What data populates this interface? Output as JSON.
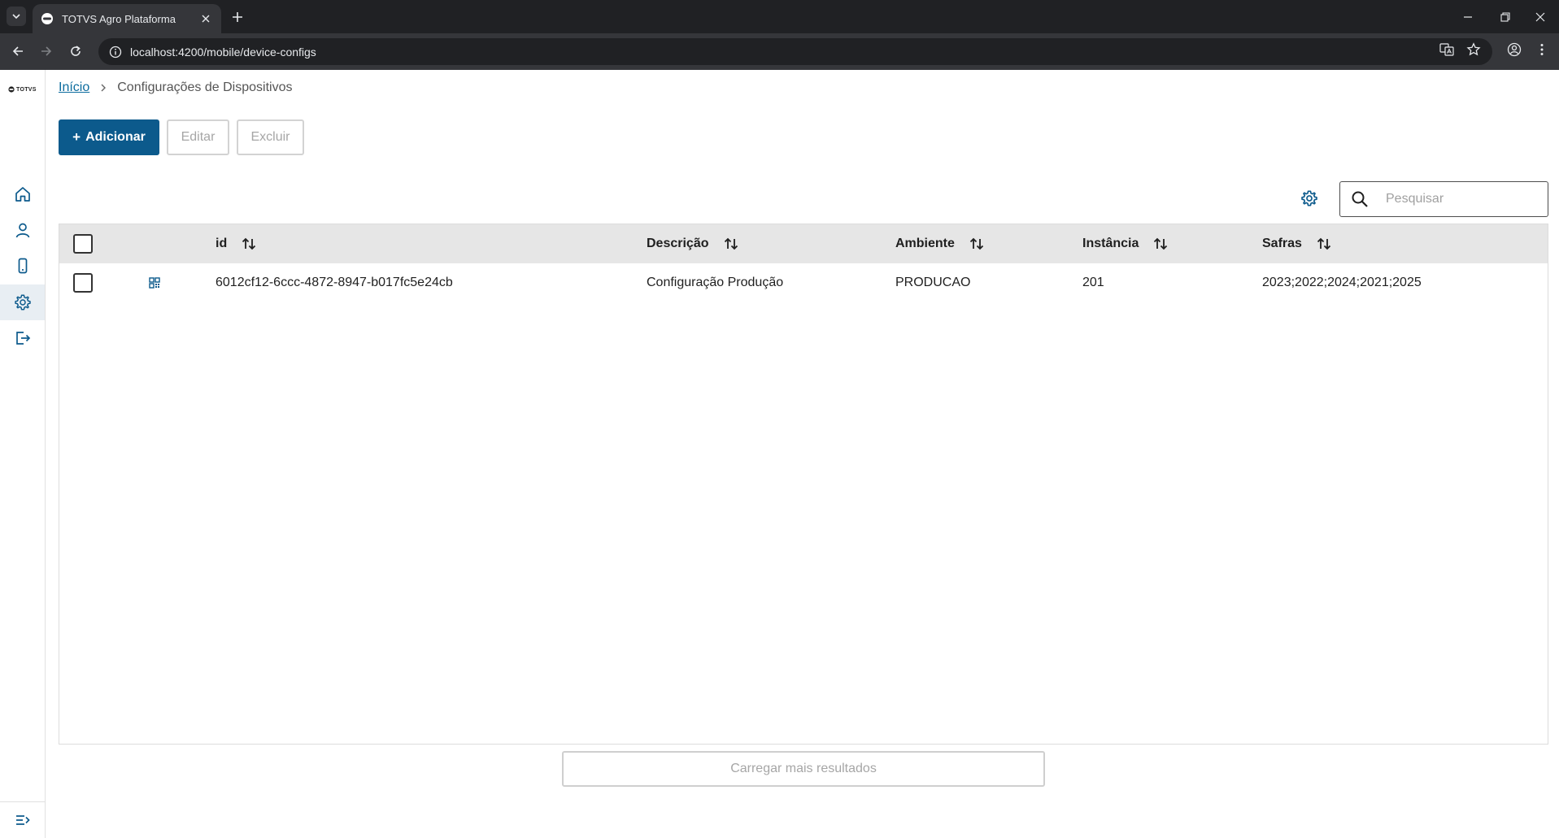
{
  "browser": {
    "tab_title": "TOTVS Agro Plataforma",
    "url": "localhost:4200/mobile/device-configs"
  },
  "sidebar": {
    "brand": "TOTVS",
    "items": [
      "home-icon",
      "user-icon",
      "mobile-device-icon",
      "gear-icon",
      "logout-icon"
    ],
    "active_index": 3
  },
  "breadcrumb": {
    "home": "Início",
    "current": "Configurações de Dispositivos"
  },
  "actions": {
    "add_plus": "+",
    "add": "Adicionar",
    "edit": "Editar",
    "delete": "Excluir"
  },
  "search": {
    "placeholder": "Pesquisar"
  },
  "table": {
    "columns": [
      "id",
      "Descrição",
      "Ambiente",
      "Instância",
      "Safras"
    ],
    "rows": [
      {
        "id": "6012cf12-6ccc-4872-8947-b017fc5e24cb",
        "descricao": "Configuração Produção",
        "ambiente": "PRODUCAO",
        "instancia": "201",
        "safras": "2023;2022;2024;2021;2025"
      }
    ]
  },
  "load_more": "Carregar mais resultados",
  "colors": {
    "primary": "#0c5a8c",
    "link": "#0c6c9e",
    "header_bg": "#e6e6e6"
  }
}
